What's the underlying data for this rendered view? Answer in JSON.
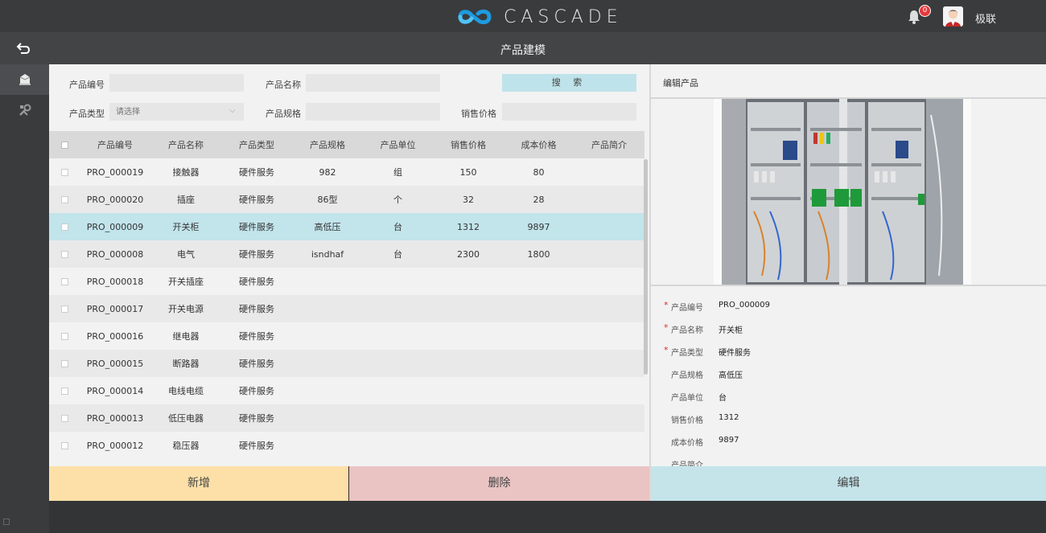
{
  "header": {
    "brand": "CASCADE",
    "notification_count": "0",
    "username": "极联"
  },
  "titlebar": {
    "title": "产品建模"
  },
  "filters": {
    "code_label": "产品编号",
    "name_label": "产品名称",
    "type_label": "产品类型",
    "type_placeholder": "请选择",
    "spec_label": "产品规格",
    "price_label": "销售价格",
    "search_label": "搜 索"
  },
  "table": {
    "columns": [
      "产品编号",
      "产品名称",
      "产品类型",
      "产品规格",
      "产品单位",
      "销售价格",
      "成本价格",
      "产品简介"
    ],
    "rows": [
      {
        "code": "PRO_000019",
        "name": "接触器",
        "type": "硬件服务",
        "spec": "982",
        "unit": "组",
        "sale": "150",
        "cost": "80",
        "desc": ""
      },
      {
        "code": "PRO_000020",
        "name": "插座",
        "type": "硬件服务",
        "spec": "86型",
        "unit": "个",
        "sale": "32",
        "cost": "28",
        "desc": ""
      },
      {
        "code": "PRO_000009",
        "name": "开关柜",
        "type": "硬件服务",
        "spec": "高低压",
        "unit": "台",
        "sale": "1312",
        "cost": "9897",
        "desc": ""
      },
      {
        "code": "PRO_000008",
        "name": "电气",
        "type": "硬件服务",
        "spec": "isndhaf",
        "unit": "台",
        "sale": "2300",
        "cost": "1800",
        "desc": ""
      },
      {
        "code": "PRO_000018",
        "name": "开关插座",
        "type": "硬件服务",
        "spec": "",
        "unit": "",
        "sale": "",
        "cost": "",
        "desc": ""
      },
      {
        "code": "PRO_000017",
        "name": "开关电源",
        "type": "硬件服务",
        "spec": "",
        "unit": "",
        "sale": "",
        "cost": "",
        "desc": ""
      },
      {
        "code": "PRO_000016",
        "name": "继电器",
        "type": "硬件服务",
        "spec": "",
        "unit": "",
        "sale": "",
        "cost": "",
        "desc": ""
      },
      {
        "code": "PRO_000015",
        "name": "断路器",
        "type": "硬件服务",
        "spec": "",
        "unit": "",
        "sale": "",
        "cost": "",
        "desc": ""
      },
      {
        "code": "PRO_000014",
        "name": "电线电缆",
        "type": "硬件服务",
        "spec": "",
        "unit": "",
        "sale": "",
        "cost": "",
        "desc": ""
      },
      {
        "code": "PRO_000013",
        "name": "低压电器",
        "type": "硬件服务",
        "spec": "",
        "unit": "",
        "sale": "",
        "cost": "",
        "desc": ""
      },
      {
        "code": "PRO_000012",
        "name": "稳压器",
        "type": "硬件服务",
        "spec": "",
        "unit": "",
        "sale": "",
        "cost": "",
        "desc": ""
      }
    ],
    "selected_index": 2
  },
  "actions": {
    "add_label": "新增",
    "delete_label": "删除",
    "edit_label": "编辑"
  },
  "detail": {
    "title": "编辑产品",
    "fields": [
      {
        "label": "产品编号",
        "value": "PRO_000009",
        "required": true
      },
      {
        "label": "产品名称",
        "value": "开关柜",
        "required": true
      },
      {
        "label": "产品类型",
        "value": "硬件服务",
        "required": true
      },
      {
        "label": "产品规格",
        "value": "高低压",
        "required": false
      },
      {
        "label": "产品单位",
        "value": "台",
        "required": false
      },
      {
        "label": "销售价格",
        "value": "1312",
        "required": false
      },
      {
        "label": "成本价格",
        "value": "9897",
        "required": false
      },
      {
        "label": "产品简介",
        "value": "",
        "required": false
      }
    ]
  },
  "colors": {
    "accent_add": "#fde0a8",
    "accent_delete": "#eac3c3",
    "accent_edit": "#c4e4ea",
    "selected_row": "#c2e4eb",
    "logo_blue": "#1e9be0"
  },
  "icons": {
    "back": "back-arrow-icon",
    "bell": "bell-icon",
    "sidebar_1": "product-box-icon",
    "sidebar_2": "tools-icon"
  }
}
